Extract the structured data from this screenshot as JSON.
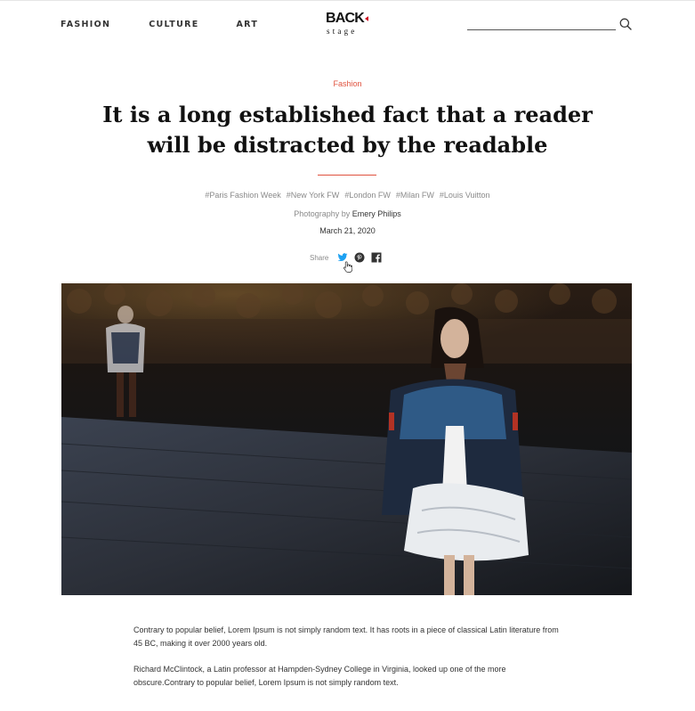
{
  "header": {
    "nav": [
      "FASHION",
      "CULTURE",
      "ART"
    ],
    "logo": {
      "word": "BACK",
      "sub": "stage",
      "accent": "#d0021b"
    },
    "search": {
      "placeholder": "",
      "icon": "search-icon"
    }
  },
  "article": {
    "category": "Fashion",
    "title_lines": [
      "It is a long established fact that a reader",
      "will be distracted by the readable"
    ],
    "accent_color": "#e0523e",
    "tags": [
      "#Paris Fashion Week",
      "#New York FW",
      "#London FW",
      "#Milan FW",
      "#Louis Vuitton"
    ],
    "credit": {
      "prefix": "Photography by",
      "name": "Emery Philips"
    },
    "date": "March 21, 2020",
    "share": {
      "label": "Share",
      "icons": [
        "twitter-icon",
        "pinterest-icon",
        "facebook-icon"
      ],
      "twitter_color": "#1da1f2"
    },
    "body": [
      "Contrary to popular belief, Lorem Ipsum is not simply random text. It has roots in a piece of classical Latin literature from 45 BC, making it over 2000 years old.",
      "Richard McClintock, a Latin professor at Hampden-Sydney College in Virginia, looked up one of the more obscure.Contrary to popular belief, Lorem Ipsum is not simply random text."
    ]
  }
}
